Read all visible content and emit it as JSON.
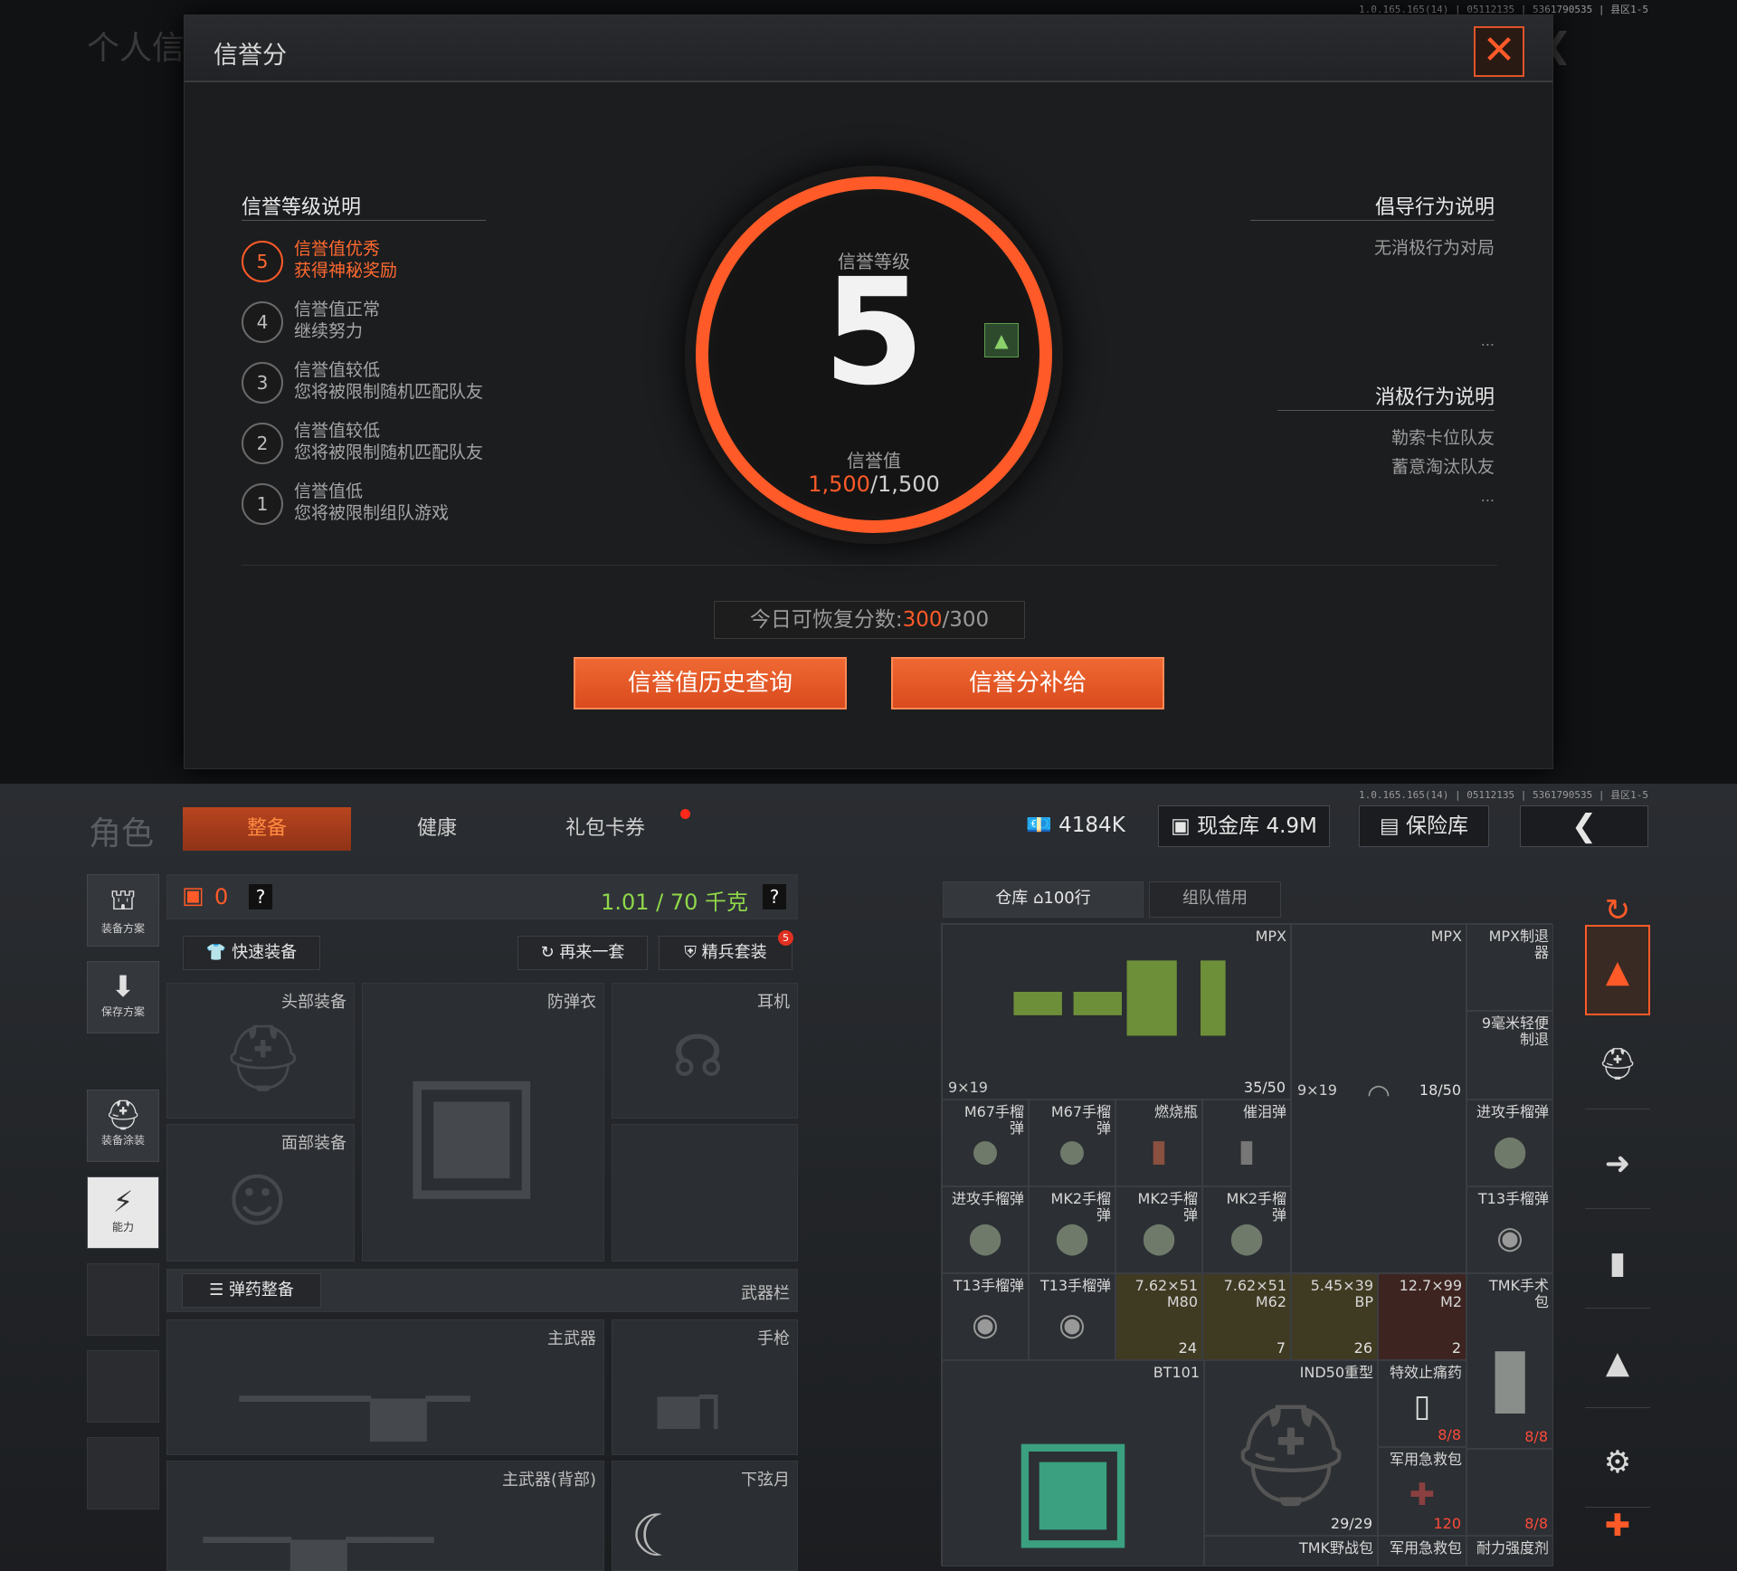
{
  "version": "1.0.165.165(14) | 05112135 | 5361790535 | 县区1-5",
  "top": {
    "bg_title": "个人信",
    "modal": {
      "title": "信誉分",
      "close_icon": "close-icon",
      "left_title": "信誉等级说明",
      "levels": [
        {
          "num": "5",
          "line1": "信誉值优秀",
          "line2": "获得神秘奖励",
          "active": true
        },
        {
          "num": "4",
          "line1": "信誉值正常",
          "line2": "继续努力",
          "active": false
        },
        {
          "num": "3",
          "line1": "信誉值较低",
          "line2": "您将被限制随机匹配队友",
          "active": false
        },
        {
          "num": "2",
          "line1": "信誉值较低",
          "line2": "您将被限制随机匹配队友",
          "active": false
        },
        {
          "num": "1",
          "line1": "信誉值低",
          "line2": "您将被限制组队游戏",
          "active": false
        }
      ],
      "ring": {
        "level_label": "信誉等级",
        "level": "5",
        "value_label": "信誉值",
        "value_current": "1,500",
        "value_max": "/1,500",
        "accent": "#ff5a28"
      },
      "right": {
        "guide_title": "倡导行为说明",
        "guide_items": [
          "无消极行为对局"
        ],
        "neg_title": "消极行为说明",
        "neg_items": [
          "勒索卡位队友",
          "蓄意淘汰队友"
        ],
        "more": "..."
      },
      "restore": {
        "label": "今日可恢复分数:",
        "current": "300",
        "max": "/300"
      },
      "buttons": {
        "history": "信誉值历史查询",
        "supplement": "信誉分补给"
      }
    }
  },
  "bottom": {
    "role_label": "角色",
    "tabs": [
      {
        "label": "整备",
        "active": true
      },
      {
        "label": "健康",
        "active": false
      },
      {
        "label": "礼包卡券",
        "active": false
      }
    ],
    "currency": {
      "cash": "4184K",
      "cash_vault": "现金库 4.9M",
      "safe": "保险库"
    },
    "left_nav": [
      {
        "label": "装备方案",
        "icon": "armor-plan-icon"
      },
      {
        "label": "保存方案",
        "icon": "save-download-icon"
      },
      {
        "label": "装备涂装",
        "icon": "helmet-paint-icon"
      },
      {
        "label": "能力",
        "icon": "ability-icon",
        "active": true
      }
    ],
    "loadout": {
      "bag_count": "0",
      "help": "?",
      "weight": "1.01 / 70 千克",
      "quick_equip": "快速装备",
      "again": "再来一套",
      "elite": "精兵套装",
      "elite_badge": "5",
      "slots": {
        "head": "头部装备",
        "vest": "防弹衣",
        "ear": "耳机",
        "face": "面部装备",
        "ammo_btn": "弹药整备",
        "weapon_bar": "武器栏",
        "primary": "主武器",
        "pistol": "手枪",
        "primary_back": "主武器(背部)",
        "melee": "下弦月"
      }
    },
    "storage": {
      "tab_warehouse": "仓库",
      "rows": "100行",
      "tab_team": "组队借用",
      "items": {
        "mpx1": {
          "name": "MPX",
          "ammo": "9×19",
          "count": "35/50"
        },
        "mpx2": {
          "name": "MPX",
          "ammo": "9×19",
          "count": "18/50"
        },
        "mpx_sup": {
          "name": "MPX制退\n器"
        },
        "mm9": {
          "name": "9毫米轻便\n制退"
        },
        "m67a": {
          "name": "M67手榴\n弹"
        },
        "m67b": {
          "name": "M67手榴\n弹"
        },
        "molotov": {
          "name": "燃烧瓶"
        },
        "tear": {
          "name": "催泪弹"
        },
        "assault_a": {
          "name": "进攻手榴弹"
        },
        "assault_b": {
          "name": "进攻手榴弹"
        },
        "mk2a": {
          "name": "MK2手榴\n弹"
        },
        "mk2b": {
          "name": "MK2手榴\n弹"
        },
        "mk2c": {
          "name": "MK2手榴\n弹"
        },
        "t13a": {
          "name": "T13手榴弹"
        },
        "t13b": {
          "name": "T13手榴弹"
        },
        "t13c": {
          "name": "T13手榴弹"
        },
        "a762m80": {
          "name": "7.62×51\nM80",
          "count": "24"
        },
        "a762m62": {
          "name": "7.62×51\nM62",
          "count": "7"
        },
        "a545bp": {
          "name": "5.45×39\nBP",
          "count": "26"
        },
        "a127m2": {
          "name": "12.7×99\nM2",
          "count": "2"
        },
        "tmk_bag": {
          "name": "TMK手术\n包"
        },
        "bt101": {
          "name": "BT101"
        },
        "ind50": {
          "name": "IND50重型",
          "count": "29/29"
        },
        "painkiller": {
          "name": "特效止痛药",
          "count": "8/8"
        },
        "medkit": {
          "name": "军用急救包",
          "count": "120"
        },
        "extra_count": "8/8",
        "bottom_names": [
          "TMK野战包",
          "军用急救包",
          "耐力强度剂"
        ]
      }
    },
    "right_tabs": [
      "hat-refresh-icon",
      "hat-icon",
      "helmet-icon",
      "rifle-icon",
      "magazine-icon",
      "bullet-icon",
      "gear-icon",
      "plus-icon"
    ]
  }
}
